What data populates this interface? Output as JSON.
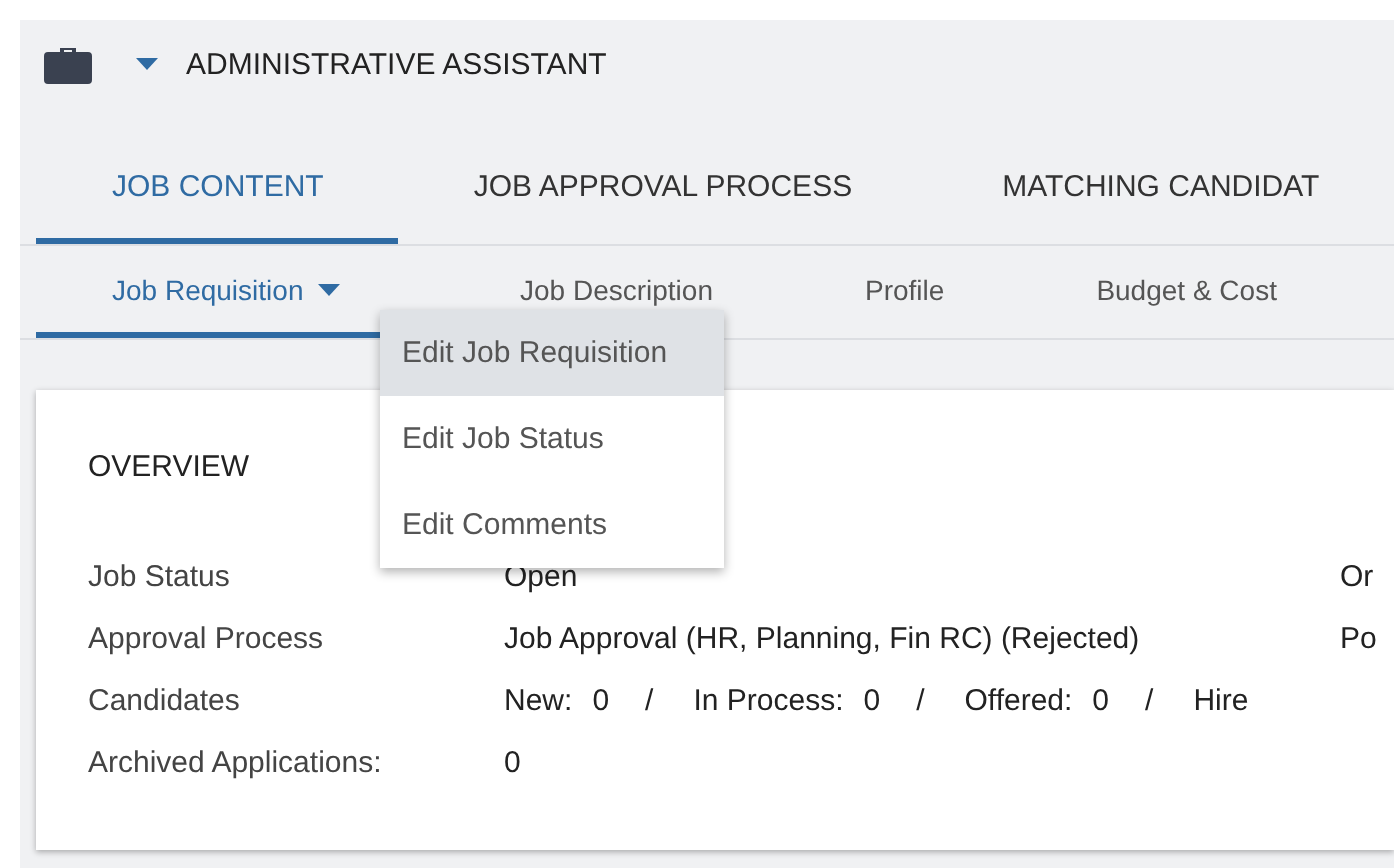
{
  "header": {
    "title": "ADMINISTRATIVE ASSISTANT"
  },
  "tabs": [
    {
      "label": "JOB CONTENT",
      "selected": true
    },
    {
      "label": "JOB APPROVAL PROCESS",
      "selected": false
    },
    {
      "label": "MATCHING CANDIDAT",
      "selected": false
    }
  ],
  "subtabs": [
    {
      "label": "Job Requisition",
      "selected": true,
      "dropdown": true
    },
    {
      "label": "Job Description",
      "selected": false,
      "dropdown": false
    },
    {
      "label": "Profile",
      "selected": false,
      "dropdown": false
    },
    {
      "label": "Budget & Cost",
      "selected": false,
      "dropdown": false
    }
  ],
  "menu": [
    {
      "label": "Edit Job Requisition",
      "selected": true
    },
    {
      "label": "Edit Job Status",
      "selected": false
    },
    {
      "label": "Edit Comments",
      "selected": false
    }
  ],
  "overview": {
    "title": "OVERVIEW",
    "rows": [
      {
        "label": "Job Status",
        "value": "Open",
        "extra": "Or"
      },
      {
        "label": "Approval Process",
        "value": "Job Approval (HR, Planning, Fin RC) (Rejected)",
        "extra": "Po"
      },
      {
        "label": "Candidates",
        "counts": [
          {
            "label": "New:",
            "value": "0"
          },
          {
            "label": "In Process:",
            "value": "0"
          },
          {
            "label": "Offered:",
            "value": "0"
          },
          {
            "label": "Hire"
          }
        ],
        "separator": "/"
      },
      {
        "label": "Archived Applications:",
        "value": "0"
      }
    ]
  }
}
